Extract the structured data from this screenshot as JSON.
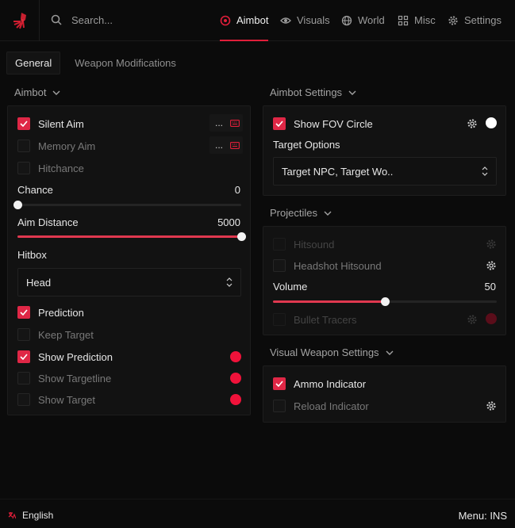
{
  "search": {
    "placeholder": "Search..."
  },
  "nav": [
    {
      "label": "Aimbot",
      "icon": "crosshair-icon",
      "active": true
    },
    {
      "label": "Visuals",
      "icon": "eye-icon"
    },
    {
      "label": "World",
      "icon": "globe-icon"
    },
    {
      "label": "Misc",
      "icon": "grid-icon"
    },
    {
      "label": "Settings",
      "icon": "gear-icon"
    }
  ],
  "subtabs": [
    "General",
    "Weapon Modifications"
  ],
  "aimbot": {
    "title": "Aimbot",
    "silent_aim": "Silent Aim",
    "memory_aim": "Memory Aim",
    "keybind_dots": "...",
    "hitchance": "Hitchance",
    "chance_label": "Chance",
    "chance_value": "0",
    "chance_fraction": 0,
    "aim_distance_label": "Aim Distance",
    "aim_distance_value": "5000",
    "aim_distance_fraction": 1,
    "hitbox_label": "Hitbox",
    "hitbox_value": "Head",
    "prediction": "Prediction",
    "keep_target": "Keep Target",
    "show_prediction": "Show Prediction",
    "show_targetline": "Show Targetline",
    "show_target": "Show Target"
  },
  "aimbot_settings": {
    "title": "Aimbot Settings",
    "show_fov": "Show FOV Circle",
    "target_options_label": "Target Options",
    "target_options_value": "Target NPC, Target Wo.."
  },
  "projectiles": {
    "title": "Projectiles",
    "hitsound": "Hitsound",
    "headshot_hitsound": "Headshot Hitsound",
    "volume_label": "Volume",
    "volume_value": "50",
    "volume_fraction": 0.5,
    "bullet_tracers": "Bullet Tracers"
  },
  "visual_weapon": {
    "title": "Visual Weapon Settings",
    "ammo_indicator": "Ammo Indicator",
    "reload_indicator": "Reload Indicator"
  },
  "footer": {
    "language": "English",
    "menu_key": "Menu: INS"
  },
  "colors": {
    "accent": "#e01e3a",
    "checkbox": "#df2746",
    "color_swatch": "#f0123a"
  }
}
